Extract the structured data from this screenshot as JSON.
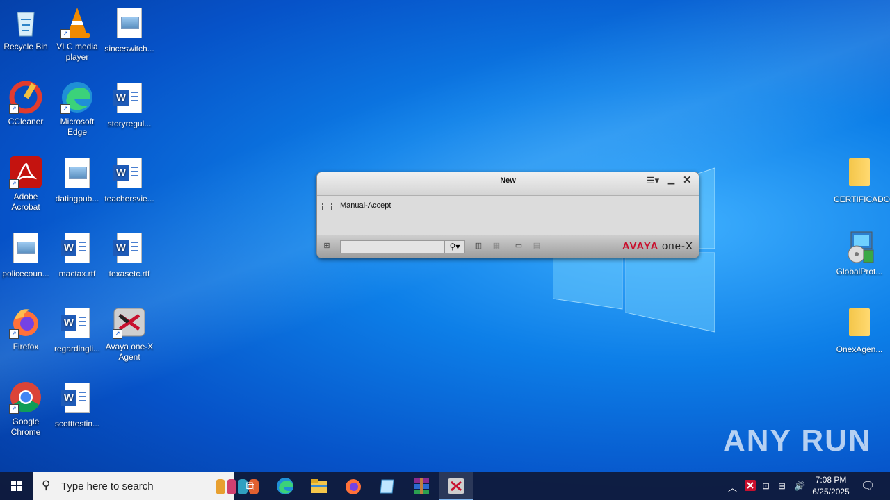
{
  "desktop_icons": [
    {
      "label": "Recycle Bin"
    },
    {
      "label": "VLC media player"
    },
    {
      "label": "sinceswitch..."
    },
    {
      "label": "CCleaner"
    },
    {
      "label": "Microsoft Edge"
    },
    {
      "label": "storyregul..."
    },
    {
      "label": "Adobe Acrobat"
    },
    {
      "label": "datingpub..."
    },
    {
      "label": "teachersvie..."
    },
    {
      "label": "policecoun..."
    },
    {
      "label": "mactax.rtf"
    },
    {
      "label": "texasetc.rtf"
    },
    {
      "label": "Firefox"
    },
    {
      "label": "regardingli..."
    },
    {
      "label": "Avaya one-X Agent"
    },
    {
      "label": "Google Chrome"
    },
    {
      "label": "scotttestin..."
    },
    {
      "label": "CERTIFICADO"
    },
    {
      "label": "GlobalProt..."
    },
    {
      "label": "OnexAgen..."
    }
  ],
  "window": {
    "title": "New",
    "checkbox_label": "Manual-Accept",
    "brand_left": "AVAYA",
    "brand_right": "one-X"
  },
  "watermark": "ANY RUN",
  "taskbar": {
    "search_placeholder": "Type here to search",
    "time": "7:08 PM",
    "date": "6/25/2025"
  },
  "colors": {
    "accent": "#0d7fe8",
    "avaya_red": "#c8102e"
  }
}
